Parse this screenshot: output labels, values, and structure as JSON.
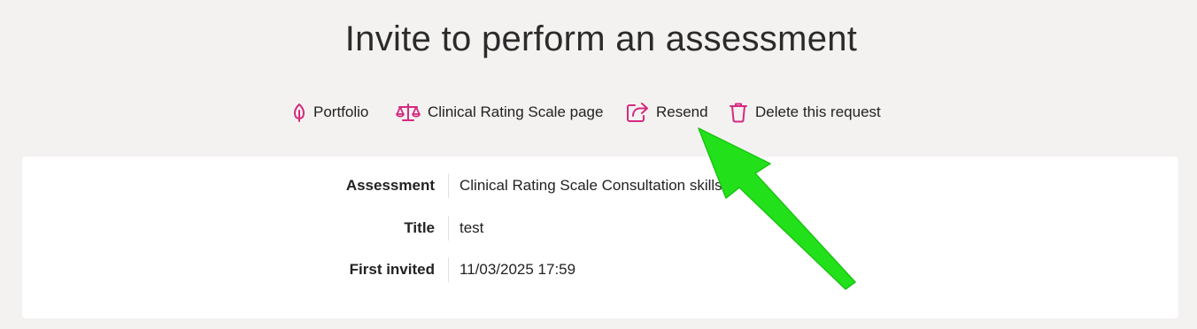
{
  "page": {
    "title": "Invite to perform an assessment"
  },
  "actions": [
    {
      "label": "Portfolio",
      "icon": "leaf-icon"
    },
    {
      "label": "Clinical Rating Scale page",
      "icon": "scales-icon"
    },
    {
      "label": "Resend",
      "icon": "share-icon"
    },
    {
      "label": "Delete this request",
      "icon": "trash-icon"
    }
  ],
  "details": [
    {
      "label": "Assessment",
      "value": "Clinical Rating Scale Consultation skills"
    },
    {
      "label": "Title",
      "value": "test"
    },
    {
      "label": "First invited",
      "value": "11/03/2025 17:59"
    }
  ],
  "colors": {
    "background": "#f3f2f1",
    "card": "#ffffff",
    "accent_icon": "#d6297f",
    "annotation_arrow": "#22e11a"
  }
}
